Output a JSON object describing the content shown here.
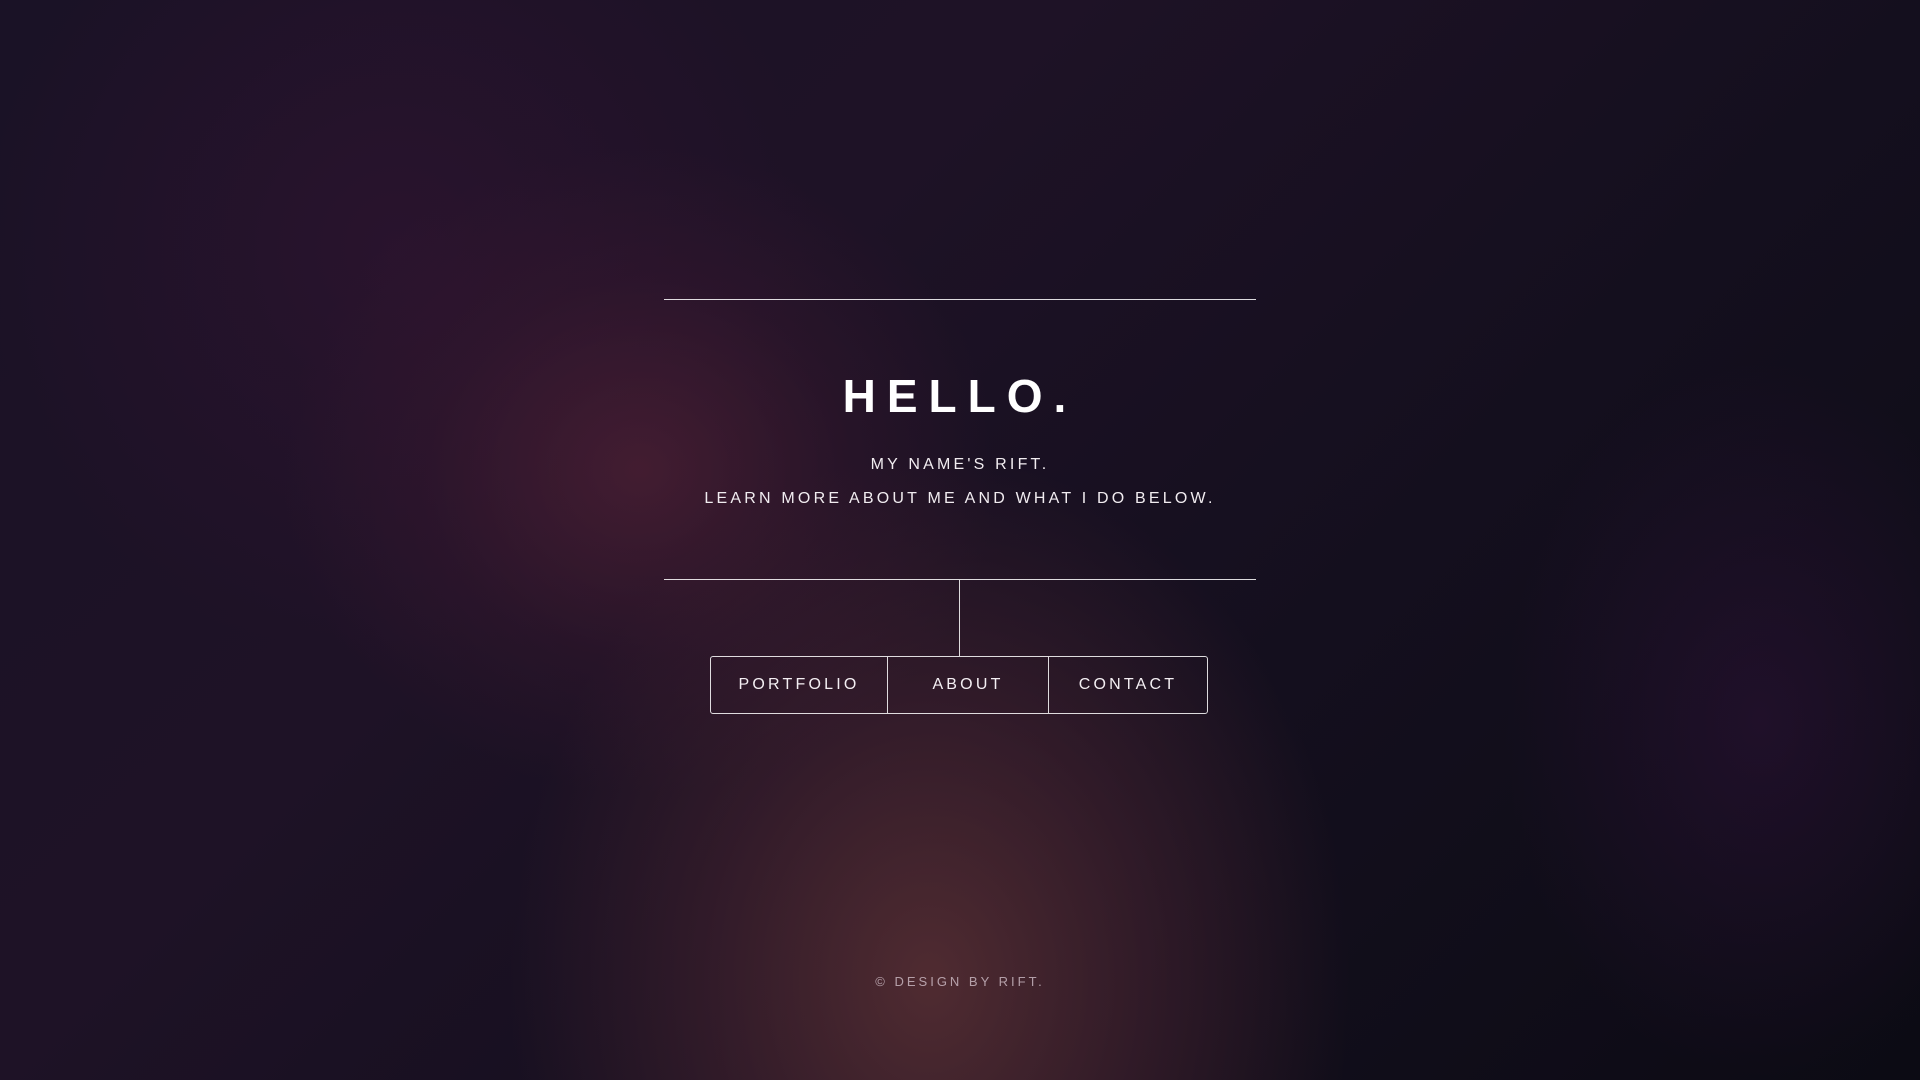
{
  "header": {
    "title": "HELLO.",
    "subtitle_line1": "MY NAME'S RIFT.",
    "subtitle_line2": "LEARN MORE ABOUT ME AND WHAT I DO BELOW."
  },
  "nav": {
    "items": [
      {
        "label": "PORTFOLIO"
      },
      {
        "label": "ABOUT"
      },
      {
        "label": "CONTACT"
      }
    ]
  },
  "footer": {
    "text": "© DESIGN BY RIFT."
  },
  "colors": {
    "text": "#ffffff",
    "background_dark": "#0c0b14",
    "background_glow": "#5a3034"
  }
}
